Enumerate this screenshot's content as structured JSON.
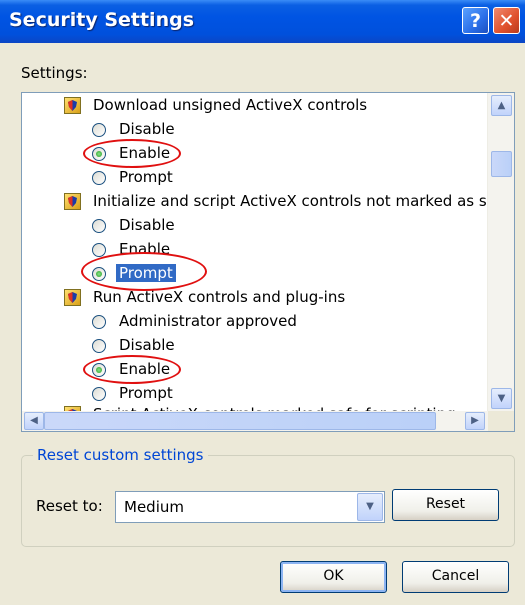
{
  "window": {
    "title": "Security Settings",
    "help_glyph": "?",
    "close_glyph": "✕"
  },
  "settings_label": "Settings:",
  "categories": [
    {
      "label": "Download unsigned ActiveX controls",
      "options": [
        "Disable",
        "Enable",
        "Prompt"
      ],
      "selected": "Enable"
    },
    {
      "label": "Initialize and script ActiveX controls not marked as safe",
      "options": [
        "Disable",
        "Enable",
        "Prompt"
      ],
      "selected": "Prompt"
    },
    {
      "label": "Run ActiveX controls and plug-ins",
      "options": [
        "Administrator approved",
        "Disable",
        "Enable",
        "Prompt"
      ],
      "selected": "Enable"
    },
    {
      "label": "Script ActiveX controls marked safe for scripting"
    }
  ],
  "reset_group": {
    "title": "Reset custom settings",
    "reset_to_label": "Reset to:",
    "reset_to_value": "Medium",
    "reset_button": "Reset"
  },
  "buttons": {
    "ok": "OK",
    "cancel": "Cancel"
  },
  "annotation_color": "#E01010",
  "icons": {
    "category": "shield-icon",
    "scroll_up": "arrow-up-icon",
    "scroll_down": "arrow-down-icon",
    "scroll_left": "arrow-left-icon",
    "scroll_right": "arrow-right-icon",
    "dropdown": "chevron-down-icon"
  }
}
